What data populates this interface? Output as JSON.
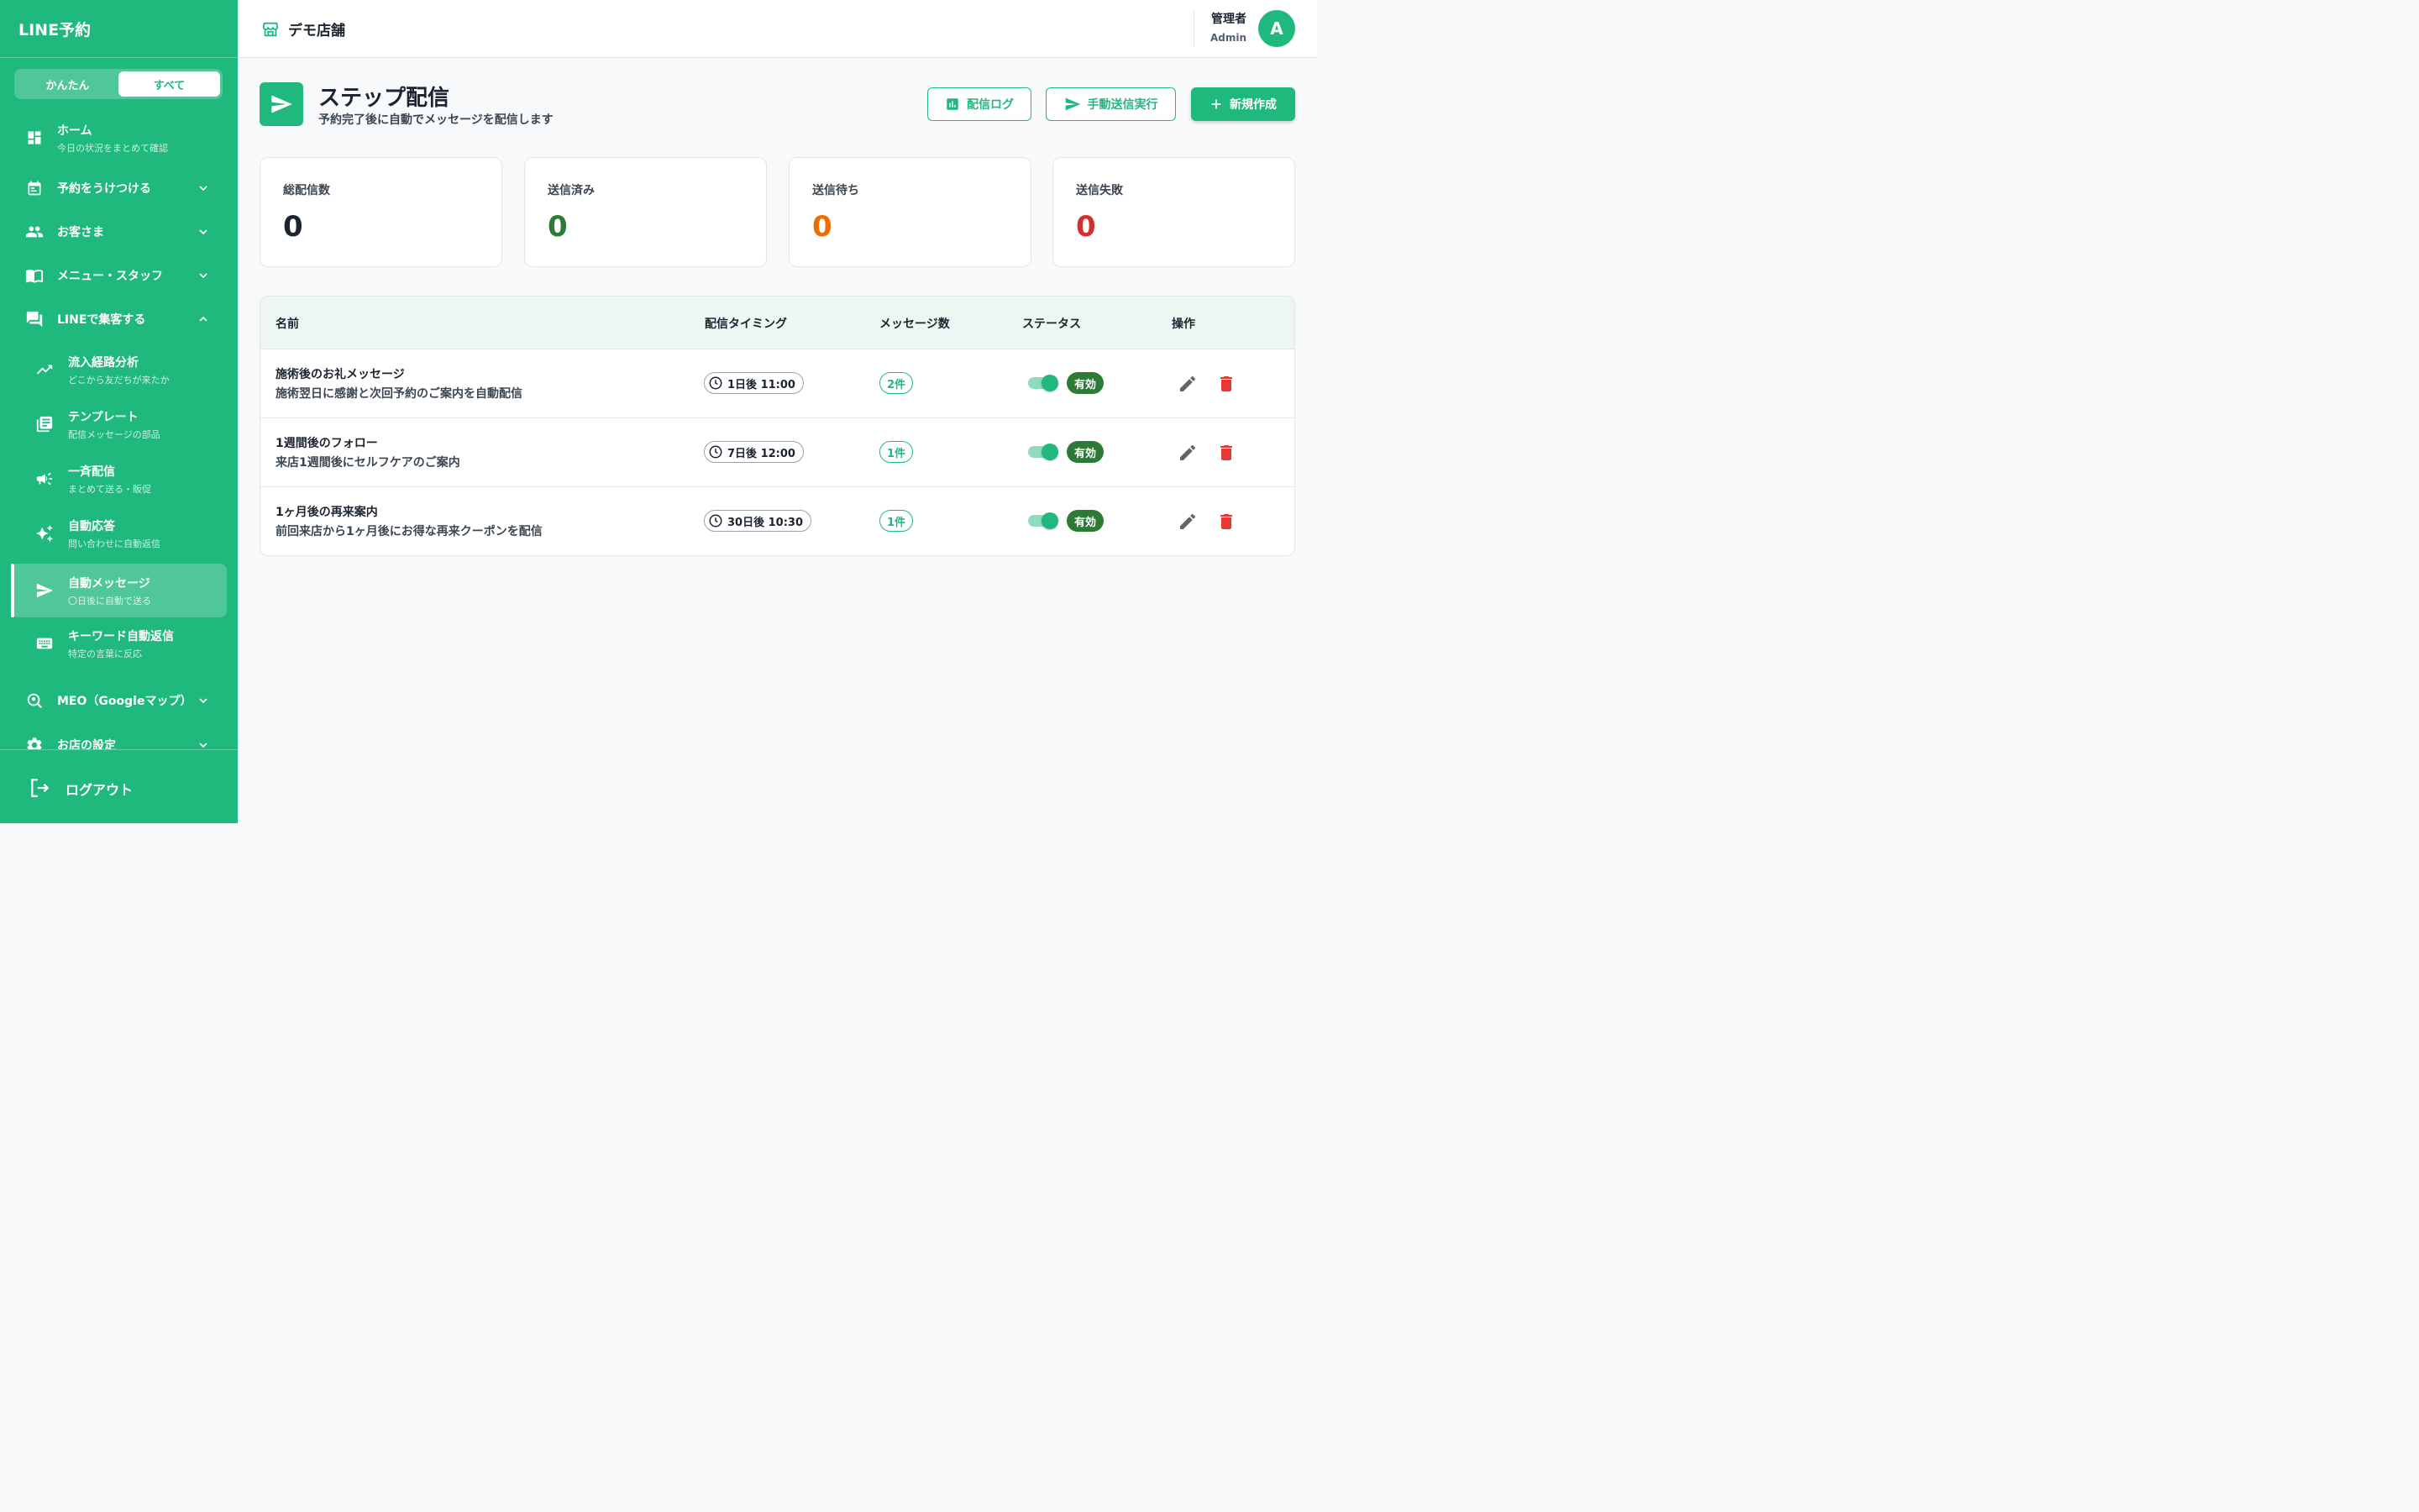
{
  "sidebar": {
    "brand": "LINE予約",
    "modes": [
      "かんたん",
      "すべて"
    ],
    "items": [
      {
        "title": "ホーム",
        "sub": "今日の状況をまとめて確認",
        "icon": "dashboard-icon"
      },
      {
        "title": "予約をうけつける",
        "icon": "calendar-icon"
      },
      {
        "title": "お客さま",
        "icon": "people-icon"
      },
      {
        "title": "メニュー・スタッフ",
        "icon": "book-icon"
      },
      {
        "title": "LINEで集客する",
        "icon": "chat-icon"
      },
      {
        "title": "流入経路分析",
        "sub": "どこから友だちが来たか",
        "icon": "trend-icon"
      },
      {
        "title": "テンプレート",
        "sub": "配信メッセージの部品",
        "icon": "library-icon"
      },
      {
        "title": "一斉配信",
        "sub": "まとめて送る・販促",
        "icon": "megaphone-icon"
      },
      {
        "title": "自動応答",
        "sub": "問い合わせに自動返信",
        "icon": "sparkle-icon"
      },
      {
        "title": "自動メッセージ",
        "sub": "〇日後に自動で送る",
        "icon": "send-icon"
      },
      {
        "title": "キーワード自動返信",
        "sub": "特定の言葉に反応",
        "icon": "keyboard-icon"
      },
      {
        "title": "MEO（Googleマップ）",
        "icon": "map-search-icon"
      },
      {
        "title": "お店の設定",
        "icon": "gear-icon"
      }
    ],
    "logout": "ログアウト"
  },
  "header": {
    "store": "デモ店舗",
    "role": "管理者",
    "user": "Admin",
    "avatar": "A"
  },
  "page": {
    "title": "ステップ配信",
    "subtitle": "予約完了後に自動でメッセージを配信します",
    "buttons": {
      "log": "配信ログ",
      "manual": "手動送信実行",
      "create": "新規作成"
    }
  },
  "stats": [
    {
      "label": "総配信数",
      "value": "0",
      "color": "#1c2430"
    },
    {
      "label": "送信済み",
      "value": "0",
      "color": "#2c7a35"
    },
    {
      "label": "送信待ち",
      "value": "0",
      "color": "#ef6c00"
    },
    {
      "label": "送信失敗",
      "value": "0",
      "color": "#d32f2f"
    }
  ],
  "table": {
    "headers": [
      "名前",
      "配信タイミング",
      "メッセージ数",
      "ステータス",
      "操作"
    ],
    "rows": [
      {
        "name": "施術後のお礼メッセージ",
        "desc": "施術翌日に感謝と次回予約のご案内を自動配信",
        "timing": "1日後 11:00",
        "count": "2件",
        "status": "有効",
        "enabled": true
      },
      {
        "name": "1週間後のフォロー",
        "desc": "来店1週間後にセルフケアのご案内",
        "timing": "7日後 12:00",
        "count": "1件",
        "status": "有効",
        "enabled": true
      },
      {
        "name": "1ヶ月後の再来案内",
        "desc": "前回来店から1ヶ月後にお得な再来クーポンを配信",
        "timing": "30日後 10:30",
        "count": "1件",
        "status": "有効",
        "enabled": true
      }
    ]
  },
  "colors": {
    "accent": "#1fb87d",
    "enabled_badge": "#2c7a35",
    "delete": "#e53935"
  }
}
